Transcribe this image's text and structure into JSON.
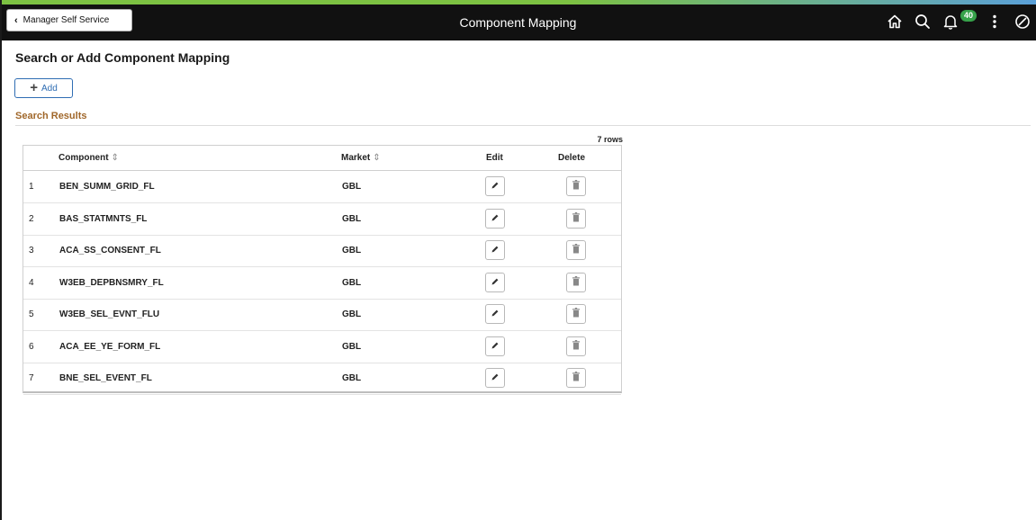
{
  "header": {
    "back_label": "Manager Self Service",
    "title": "Component Mapping",
    "notification_count": "40",
    "icons": [
      "home-icon",
      "search-icon",
      "notification-icon",
      "actions-menu-icon",
      "navbar-icon"
    ]
  },
  "page": {
    "title": "Search or Add Component Mapping",
    "add_label": "Add",
    "section_title": "Search Results",
    "row_count": "7 rows"
  },
  "table": {
    "columns": {
      "component": "Component",
      "market": "Market",
      "edit": "Edit",
      "delete": "Delete"
    },
    "rows": [
      {
        "num": "1",
        "component": "BEN_SUMM_GRID_FL",
        "market": "GBL"
      },
      {
        "num": "2",
        "component": "BAS_STATMNTS_FL",
        "market": "GBL"
      },
      {
        "num": "3",
        "component": "ACA_SS_CONSENT_FL",
        "market": "GBL"
      },
      {
        "num": "4",
        "component": "W3EB_DEPBNSMRY_FL",
        "market": "GBL"
      },
      {
        "num": "5",
        "component": "W3EB_SEL_EVNT_FLU",
        "market": "GBL"
      },
      {
        "num": "6",
        "component": "ACA_EE_YE_FORM_FL",
        "market": "GBL"
      },
      {
        "num": "7",
        "component": "BNE_SEL_EVENT_FL",
        "market": "GBL"
      }
    ]
  },
  "colors": {
    "banner": "#111111",
    "accent": "#2f6db3",
    "section_title": "#a0672a",
    "badge": "#36a24a"
  }
}
